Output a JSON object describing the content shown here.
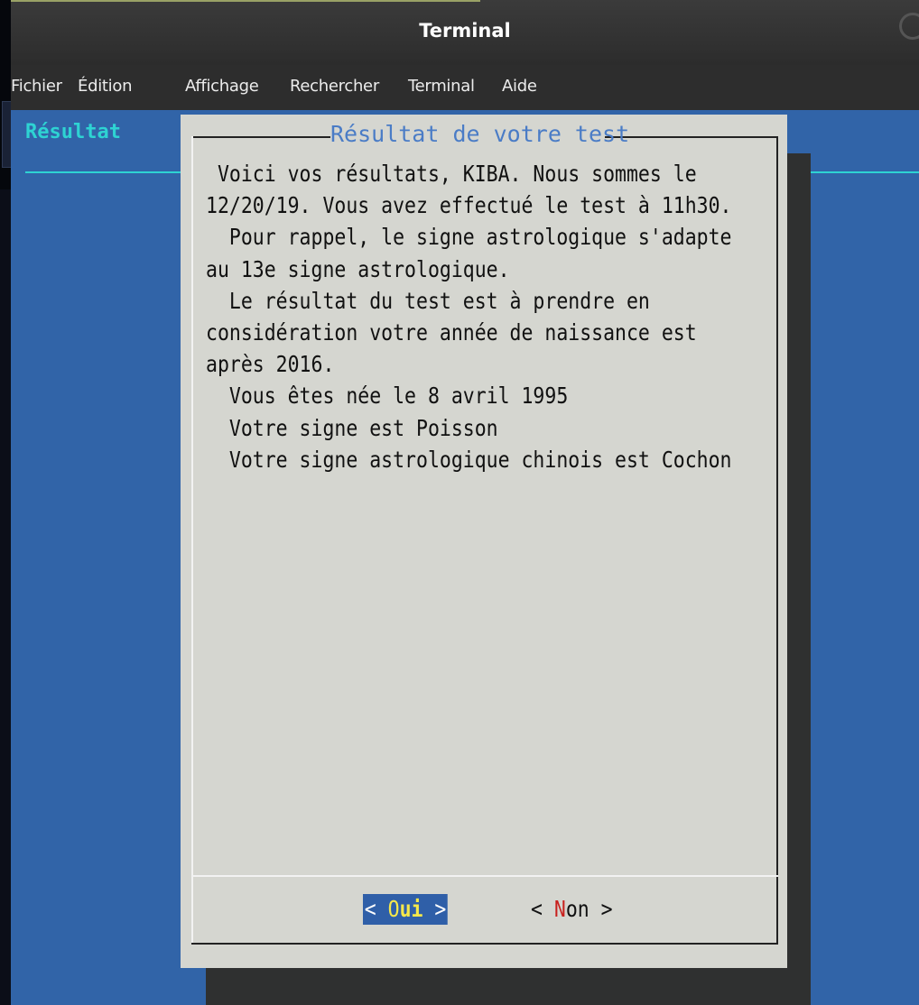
{
  "window": {
    "title": "Terminal"
  },
  "menu": [
    "Fichier",
    "Édition",
    "Affichage",
    "Rechercher",
    "Terminal",
    "Aide"
  ],
  "terminal": {
    "backtitle": "Résultat"
  },
  "dialog": {
    "title": "Résultat de votre test",
    "body": " Voici vos résultats, KIBA. Nous sommes le\n12/20/19. Vous avez effectué le test à 11h30.\n  Pour rappel, le signe astrologique s'adapte\nau 13e signe astrologique.\n  Le résultat du test est à prendre en\nconsidération votre année de naissance est\naprès 2016.\n  Vous êtes née le 8 avril 1995\n  Votre signe est Poisson\n  Votre signe astrologique chinois est Cochon",
    "buttons": {
      "yes": {
        "open": "< ",
        "hotkey": "O",
        "rest": "ui",
        "close": " >"
      },
      "no": {
        "open": "< ",
        "hotkey": "N",
        "rest": "on",
        "close": " >"
      }
    }
  },
  "colors": {
    "terminal_background": "#3164a8",
    "dialog_background": "#d5d6d0",
    "dialog_title": "#4a7cc6",
    "backtitle": "#2ed3d3",
    "selected_button": "#2f5fa8",
    "hotkey_selected": "#f6e84a",
    "hotkey_unselected": "#c8211e"
  }
}
